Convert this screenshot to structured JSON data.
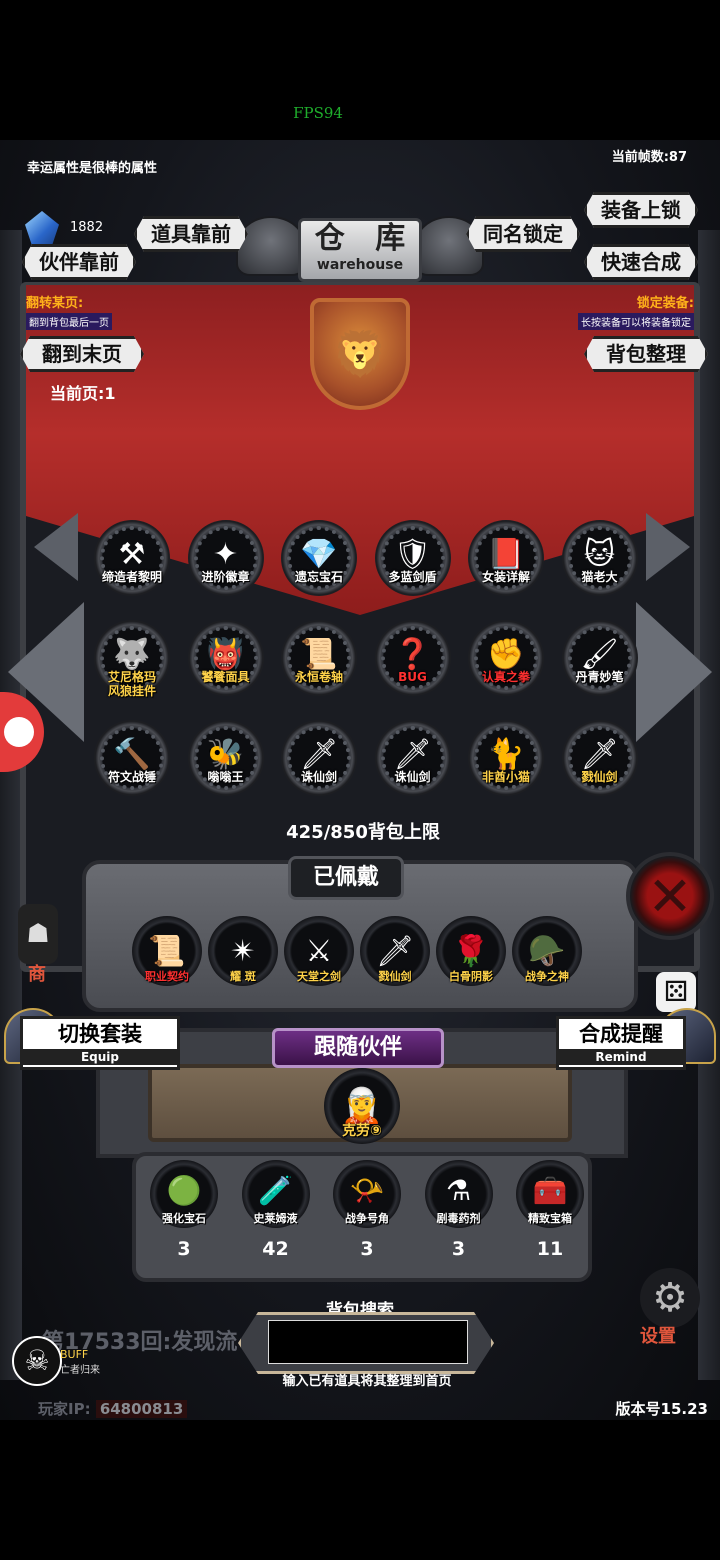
{
  "fps_overlay": "FPS94",
  "header": {
    "tip": "幸运属性是很棒的属性",
    "current_fps": "当前帧数:87",
    "gem_count": "1882"
  },
  "warehouse": {
    "title_cn": "仓 库",
    "title_en": "warehouse",
    "buttons": {
      "items_front": "道具靠前",
      "partner_front": "伙伴靠前",
      "same_name_lock": "同名锁定",
      "equip_lock": "装备上锁",
      "quick_synth": "快速合成",
      "goto_last": "翻到末页",
      "sort_bag": "背包整理"
    },
    "flip_info": {
      "title": "翻转某页:",
      "sub": "翻到背包最后一页"
    },
    "lock_info": {
      "title": "锁定装备:",
      "sub": "长按装备可以将装备锁定"
    },
    "current_page": "当前页:1",
    "items": [
      {
        "label": "缔造者黎明",
        "icon": "hammer-icon",
        "glyph": "⚒",
        "color": "#fff"
      },
      {
        "label": "进阶徽章",
        "icon": "star-badge-icon",
        "glyph": "✦",
        "color": "#fff"
      },
      {
        "label": "遗忘宝石",
        "icon": "crystal-icon",
        "glyph": "💎",
        "color": "#fff"
      },
      {
        "label": "多蓝剑盾",
        "icon": "shield-icon",
        "glyph": "🛡",
        "color": "#fff"
      },
      {
        "label": "女装详解",
        "icon": "book-icon",
        "glyph": "📕",
        "color": "#fff"
      },
      {
        "label": "猫老大",
        "icon": "cat-icon",
        "glyph": "🐱",
        "color": "#fff"
      },
      {
        "label": "艾尼格玛\n风狼挂件",
        "icon": "wolf-pendant-icon",
        "glyph": "🐺",
        "color": "#ffd34a"
      },
      {
        "label": "饕餮面具",
        "icon": "mask-icon",
        "glyph": "👹",
        "color": "#ffd34a"
      },
      {
        "label": "永恒卷轴",
        "icon": "scroll-icon",
        "glyph": "📜",
        "color": "#ffd34a"
      },
      {
        "label": "BUG",
        "icon": "bug-icon",
        "glyph": "❓",
        "color": "#ff3030"
      },
      {
        "label": "认真之拳",
        "icon": "fist-icon",
        "glyph": "✊",
        "color": "#ff3030"
      },
      {
        "label": "丹青妙笔",
        "icon": "brush-icon",
        "glyph": "🖌",
        "color": "#fff"
      },
      {
        "label": "符文战锤",
        "icon": "war-hammer-icon",
        "glyph": "🔨",
        "color": "#fff"
      },
      {
        "label": "嗡嗡王",
        "icon": "beast-icon",
        "glyph": "🐝",
        "color": "#fff"
      },
      {
        "label": "诛仙剑",
        "icon": "sword-icon",
        "glyph": "🗡",
        "color": "#fff"
      },
      {
        "label": "诛仙剑",
        "icon": "sword-icon",
        "glyph": "🗡",
        "color": "#fff"
      },
      {
        "label": "非酋小猫",
        "icon": "black-cat-icon",
        "glyph": "🐈",
        "color": "#ffd34a"
      },
      {
        "label": "戮仙剑",
        "icon": "sword-icon",
        "glyph": "🗡",
        "color": "#ffd34a"
      }
    ],
    "capacity": "425/850背包上限"
  },
  "equipped": {
    "title": "已佩戴",
    "items": [
      {
        "label": "职业契约",
        "icon": "contract-icon",
        "glyph": "📜",
        "color": "#ff3030"
      },
      {
        "label": "耀 斑",
        "icon": "flare-icon",
        "glyph": "✴",
        "color": "#ffd34a"
      },
      {
        "label": "天堂之剑",
        "icon": "golden-sword-icon",
        "glyph": "⚔",
        "color": "#ffd34a"
      },
      {
        "label": "戮仙剑",
        "icon": "sword-icon",
        "glyph": "🗡",
        "color": "#ffd34a"
      },
      {
        "label": "白骨阴影",
        "icon": "rose-icon",
        "glyph": "🌹",
        "color": "#ffd34a"
      },
      {
        "label": "战争之神",
        "icon": "war-god-icon",
        "glyph": "🪖",
        "color": "#ffd34a"
      }
    ]
  },
  "outfit": {
    "switch_cn": "切换套装",
    "switch_en": "Equip",
    "remind_cn": "合成提醒",
    "remind_en": "Remind"
  },
  "follow": {
    "title": "跟随伙伴",
    "partner": "克劳⑨"
  },
  "consumables": [
    {
      "label": "强化宝石",
      "icon": "green-gem-icon",
      "glyph": "🟢",
      "count": "3"
    },
    {
      "label": "史莱姆液",
      "icon": "potion-icon",
      "glyph": "🧪",
      "count": "42"
    },
    {
      "label": "战争号角",
      "icon": "horn-icon",
      "glyph": "📯",
      "count": "3"
    },
    {
      "label": "剧毒药剂",
      "icon": "poison-bottle-icon",
      "glyph": "⚗",
      "count": "3"
    },
    {
      "label": "精致宝箱",
      "icon": "chest-icon",
      "glyph": "🧰",
      "count": "11"
    }
  ],
  "side": {
    "shop_label": "商",
    "settings_label": "设置",
    "buff_label": "BUFF",
    "buff_sub": "亡者归来"
  },
  "search": {
    "label": "背包搜索",
    "value": "",
    "hint": "输入已有道具将其整理到首页"
  },
  "footer": {
    "ticker": "第17533回:发现流",
    "player_ip_label": "玩家IP:",
    "player_ip": "64800813",
    "version": "版本号15.23"
  }
}
